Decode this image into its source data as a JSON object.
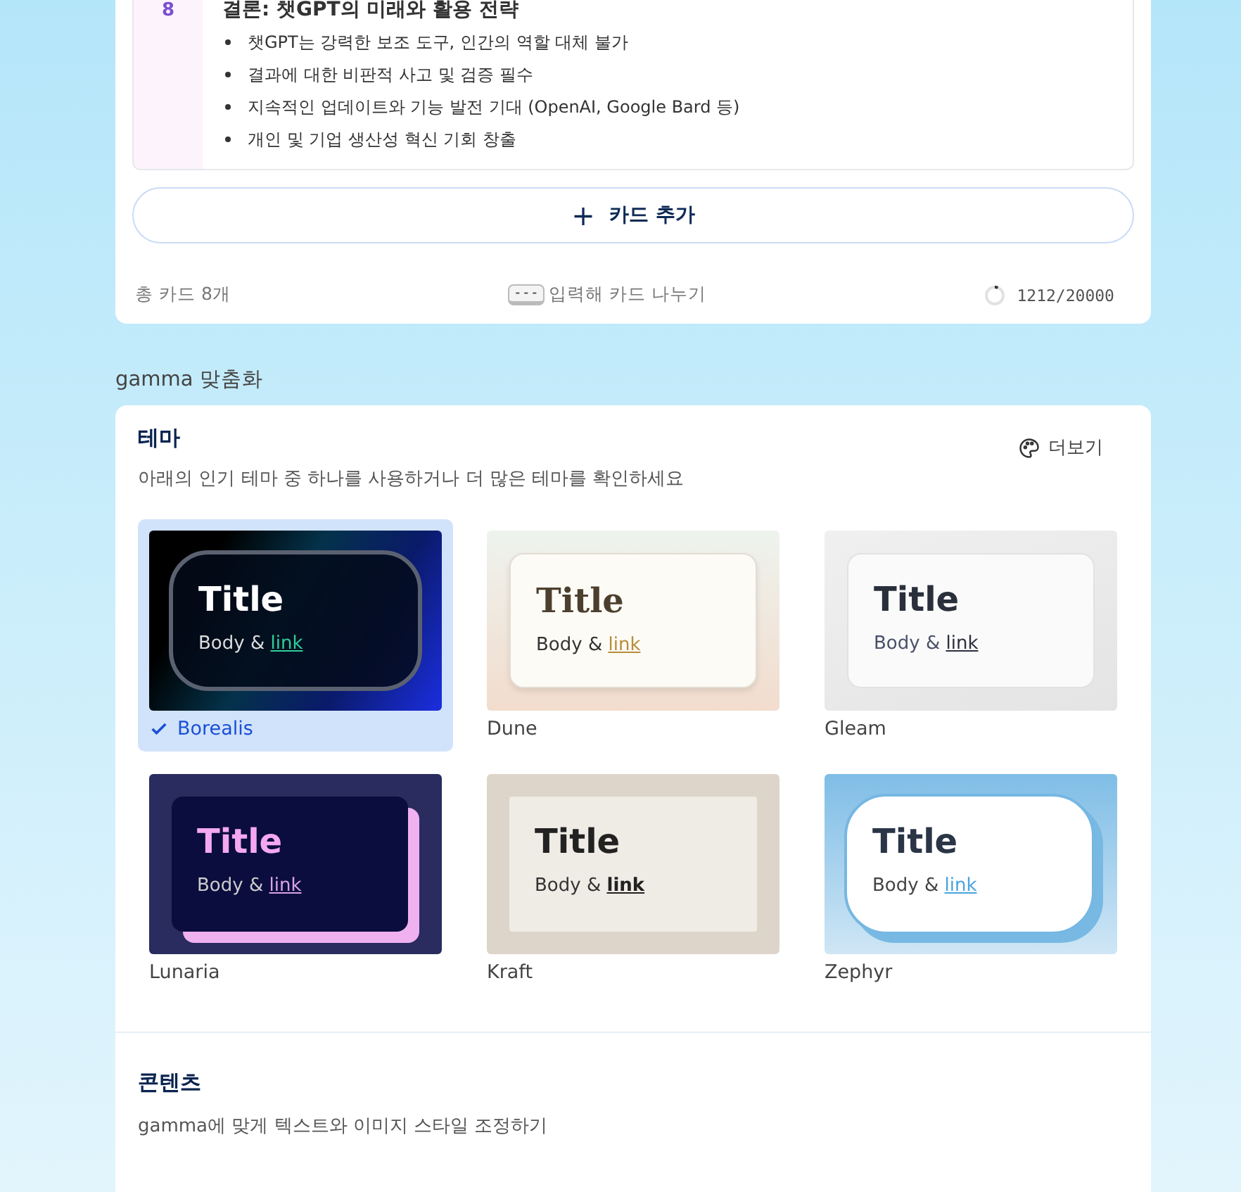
{
  "card": {
    "number": "8",
    "title": "결론: 챗GPT의 미래와 활용 전략",
    "bullets": [
      "챗GPT는 강력한 보조 도구, 인간의 역할 대체 불가",
      "결과에 대한 비판적 사고 및 검증 필수",
      "지속적인 업데이트와 기능 발전 기대 (OpenAI, Google Bard 등)",
      "개인 및 기업 생산성 혁신 기회 창출"
    ]
  },
  "add_card_button": {
    "icon": "+",
    "label": "카드 추가"
  },
  "footer": {
    "total": "총 카드 8개",
    "key": "---",
    "hint": "입력해 카드 나누기",
    "counter": "1212/20000"
  },
  "section_label": "gamma 맞춤화",
  "theme_panel": {
    "title": "테마",
    "description": "아래의 인기 테마 중 하나를 사용하거나 더 많은 테마를 확인하세요",
    "more_button": "더보기",
    "themes": [
      {
        "name": "Borealis",
        "selected": true,
        "title": "Title",
        "body": "Body &",
        "link": "link"
      },
      {
        "name": "Dune",
        "selected": false,
        "title": "Title",
        "body": "Body &",
        "link": "link"
      },
      {
        "name": "Gleam",
        "selected": false,
        "title": "Title",
        "body": "Body &",
        "link": "link"
      },
      {
        "name": "Lunaria",
        "selected": false,
        "title": "Title",
        "body": "Body &",
        "link": "link"
      },
      {
        "name": "Kraft",
        "selected": false,
        "title": "Title",
        "body": "Body &",
        "link": "link"
      },
      {
        "name": "Zephyr",
        "selected": false,
        "title": "Title",
        "body": "Body &",
        "link": "link"
      }
    ]
  },
  "content_panel": {
    "title": "콘텐츠",
    "description": "gamma에 맞게 텍스트와 이미지 스타일 조정하기"
  }
}
